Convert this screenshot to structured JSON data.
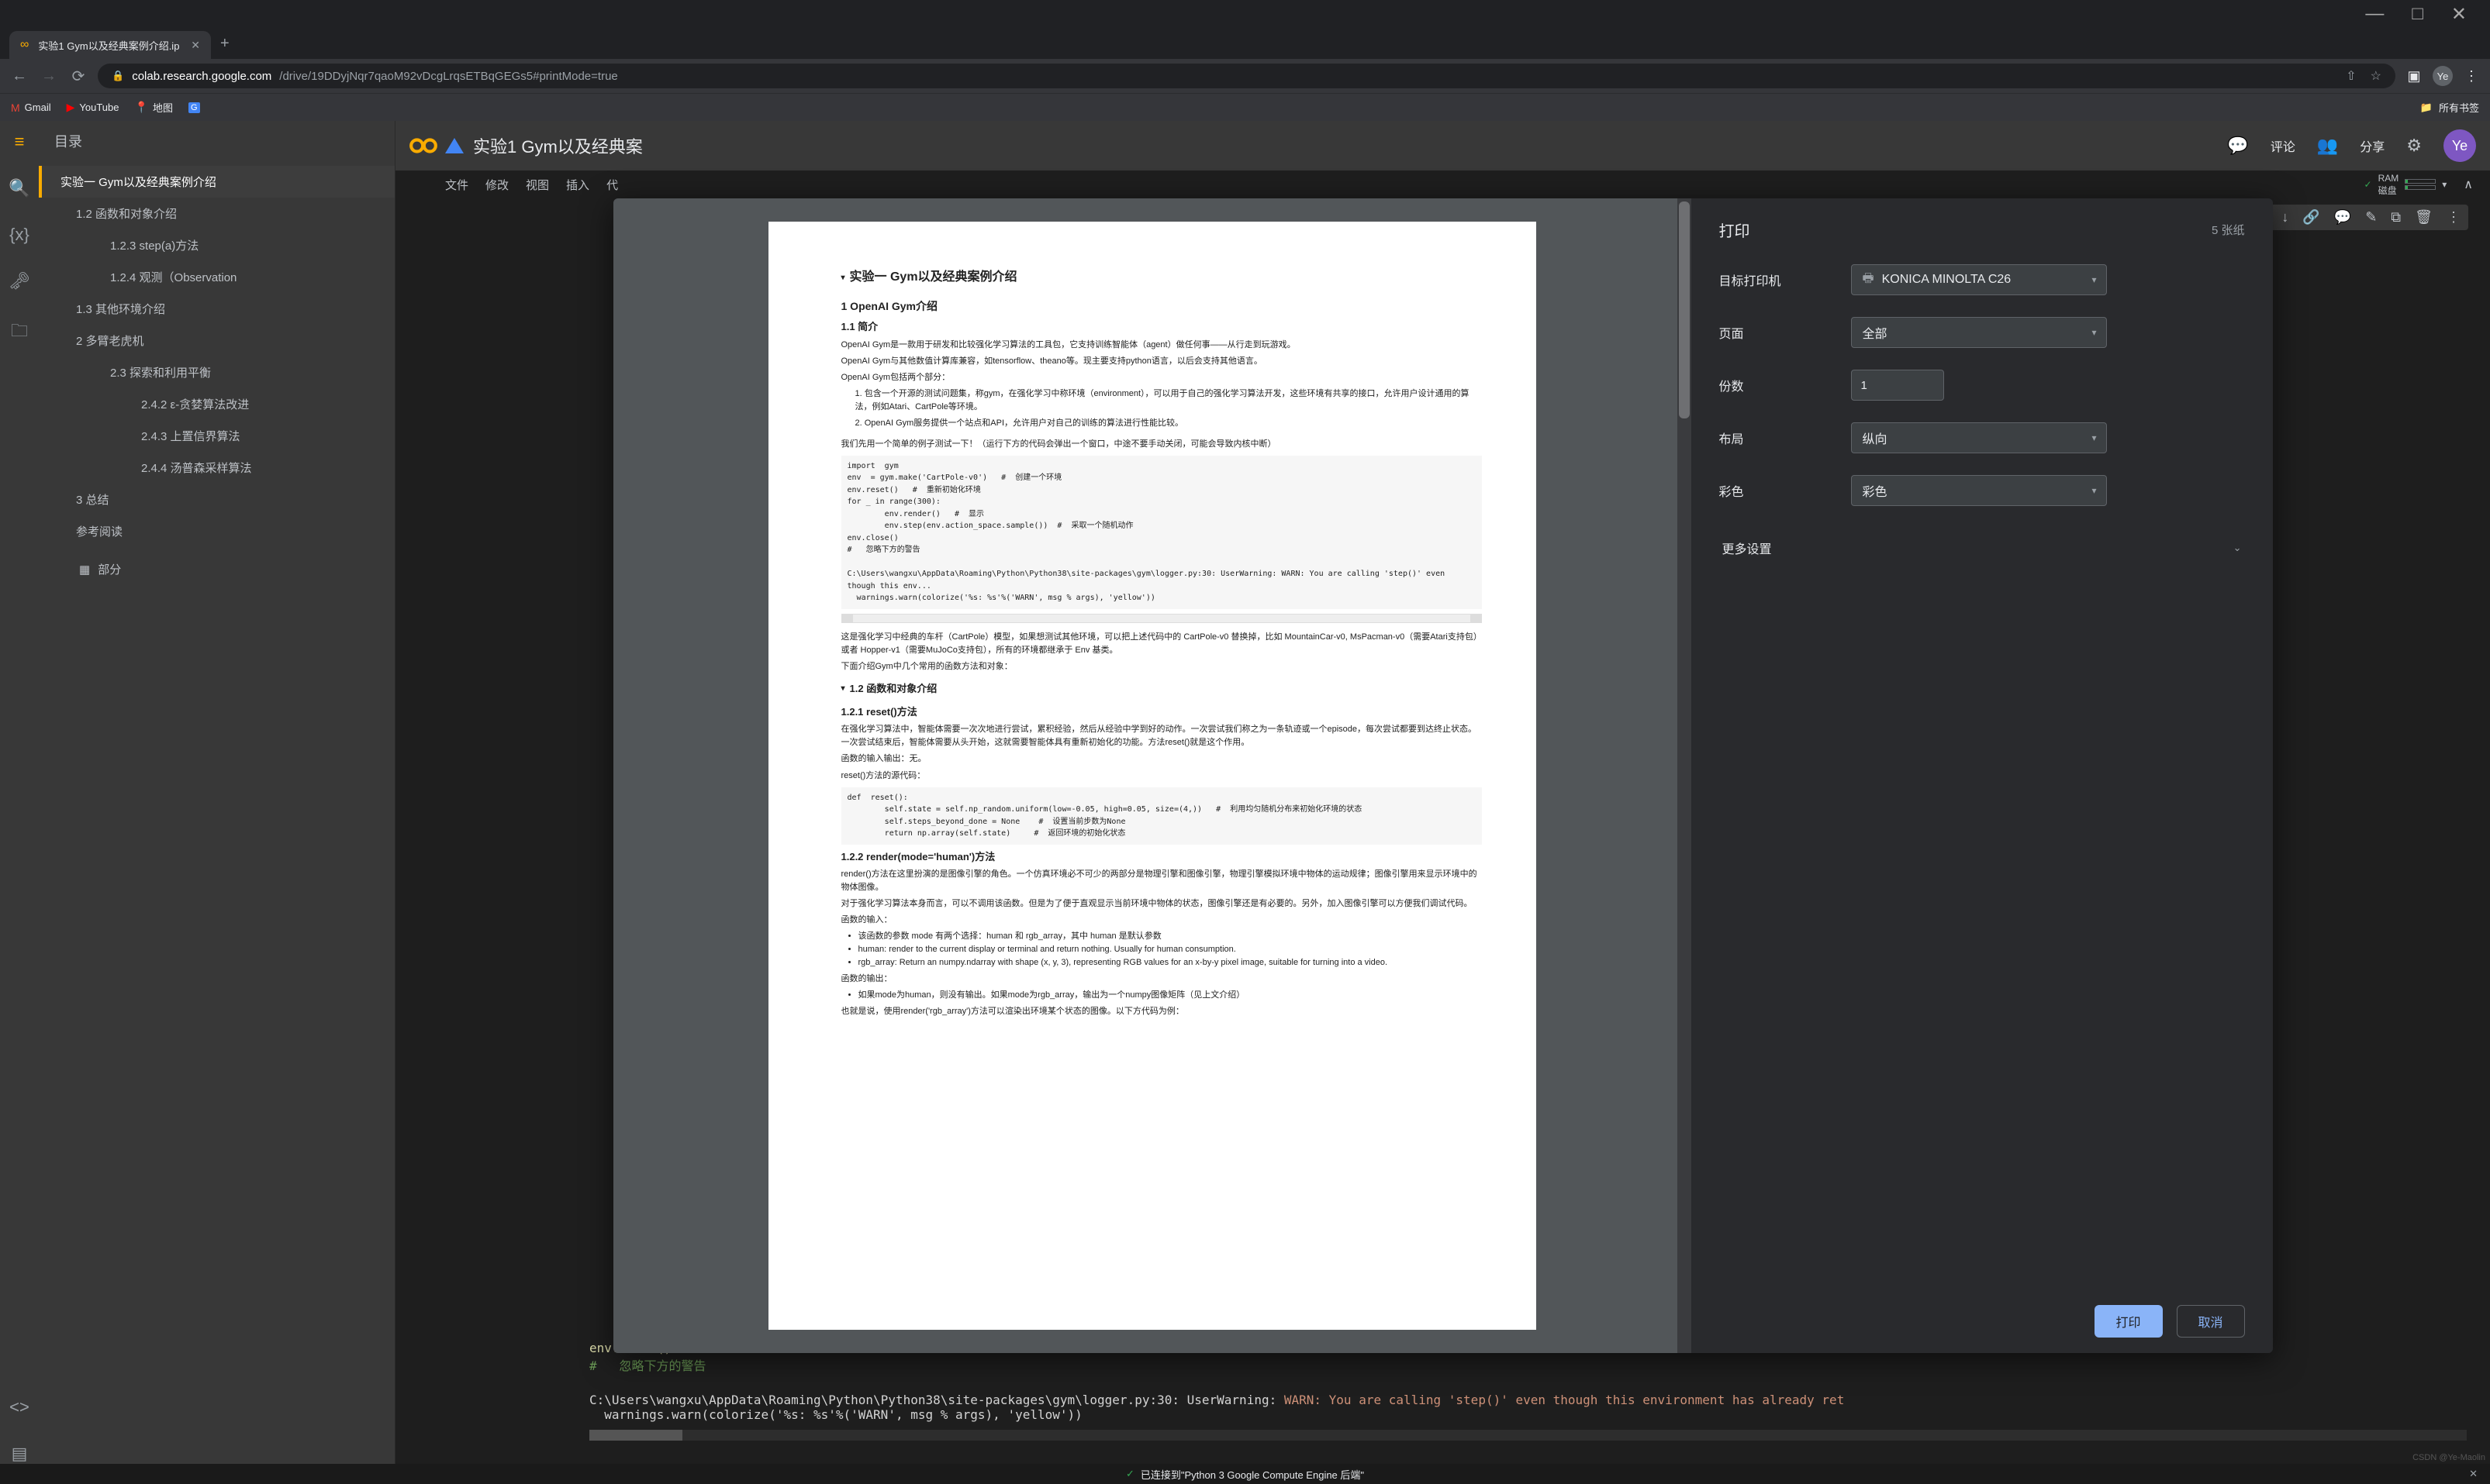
{
  "browser": {
    "tab_title": "实验1 Gym以及经典案例介绍.ip",
    "tab_close": "✕",
    "url_host": "colab.research.google.com",
    "url_path": "/drive/19DDyjNqr7qaoM92vDcgLrqsETBqGEGs5#printMode=true",
    "bookmarks": {
      "gmail": "Gmail",
      "youtube": "YouTube",
      "maps": "地图",
      "all": "所有书签"
    },
    "win_min": "—",
    "win_max": "□",
    "win_close": "✕",
    "avatar": "Ye"
  },
  "colab": {
    "doc_title": "实验1 Gym以及经典案",
    "menu": {
      "file": "文件",
      "edit": "修改",
      "view": "视图",
      "insert": "插入",
      "code": "代"
    },
    "hdr": {
      "comment": "评论",
      "share": "分享",
      "avatar": "Ye"
    },
    "ram": {
      "check": "✓",
      "ram": "RAM",
      "disk": "磁盘"
    },
    "toc": {
      "title": "目录",
      "items": {
        "a": "实验一 Gym以及经典案例介绍",
        "b": "1.2 函数和对象介绍",
        "c": "1.2.3 step(a)方法",
        "d": "1.2.4 观测（Observation",
        "e": "1.3 其他环境介绍",
        "f": "2 多臂老虎机",
        "g": "2.3 探索和利用平衡",
        "h": "2.4.2 ε-贪婪算法改进",
        "i": "2.4.3 上置信界算法",
        "j": "2.4.4 汤普森采样算法",
        "k": "3 总结",
        "l": "参考阅读",
        "add": "部分"
      }
    },
    "output": {
      "l1": "env.close()",
      "l2a": "#   ",
      "l2b": "忽略下方的警告",
      "l3a": "C:\\Users\\wangxu\\AppData\\Roaming\\Python\\Python38\\site-packages\\gym\\logger.py:30: UserWarning: ",
      "l3b": "WARN: You are calling 'step()' even though this environment has already ret",
      "l4": "  warnings.warn(colorize('%s: %s'%('WARN', msg % args), 'yellow'))"
    }
  },
  "print": {
    "title": "打印",
    "sheets": "5 张纸",
    "rows": {
      "dest_lbl": "目标打印机",
      "dest_val": "KONICA MINOLTA C26",
      "pages_lbl": "页面",
      "pages_val": "全部",
      "copies_lbl": "份数",
      "copies_val": "1",
      "layout_lbl": "布局",
      "layout_val": "纵向",
      "color_lbl": "彩色",
      "color_val": "彩色"
    },
    "more": "更多设置",
    "print_btn": "打印",
    "cancel_btn": "取消"
  },
  "doc": {
    "h1": "实验一 Gym以及经典案例介绍",
    "h2": "1 OpenAI Gym介绍",
    "h3": "1.1 简介",
    "p1": "OpenAI Gym是一款用于研发和比较强化学习算法的工具包，它支持训练智能体（agent）做任何事——从行走到玩游戏。",
    "p2": "OpenAI Gym与其他数值计算库兼容，如tensorflow、theano等。现主要支持python语言，以后会支持其他语言。",
    "p3": "OpenAI Gym包括两个部分：",
    "li1": "1. 包含一个开源的测试问题集，称gym，在强化学习中称环境（environment），可以用于自己的强化学习算法开发，这些环境有共享的接口，允许用户设计通用的算法，例如Atari、CartPole等环境。",
    "li2": "2. OpenAI Gym服务提供一个站点和API，允许用户对自己的训练的算法进行性能比较。",
    "p4": "我们先用一个简单的例子测试一下！（运行下方的代码会弹出一个窗口，中途不要手动关闭，可能会导致内核中断）",
    "code1": "import  gym\nenv  = gym.make('CartPole-v0')   #  创建一个环境\nenv.reset()   #  重新初始化环境\nfor _ in range(300):\n        env.render()   #  显示\n        env.step(env.action_space.sample())  #  采取一个随机动作\nenv.close()\n#   忽略下方的警告\n\nC:\\Users\\wangxu\\AppData\\Roaming\\Python\\Python38\\site-packages\\gym\\logger.py:30: UserWarning: WARN: You are calling 'step()' even though this env...\n  warnings.warn(colorize('%s: %s'%('WARN', msg % args), 'yellow'))",
    "p5": "这是强化学习中经典的车杆（CartPole）模型，如果想测试其他环境，可以把上述代码中的 CartPole-v0 替换掉，比如 MountainCar-v0, MsPacman-v0（需要Atari支持包）或者 Hopper-v1（需要MuJoCo支持包），所有的环境都继承于 Env 基类。",
    "p6": "下面介绍Gym中几个常用的函数方法和对象：",
    "h4": "1.2 函数和对象介绍",
    "h5": "1.2.1 reset()方法",
    "p7": "在强化学习算法中，智能体需要一次次地进行尝试，累积经验，然后从经验中学到好的动作。一次尝试我们称之为一条轨迹或一个episode，每次尝试都要到达终止状态。一次尝试结束后，智能体需要从头开始，这就需要智能体具有重新初始化的功能。方法reset()就是这个作用。",
    "p8": "函数的输入输出：无。",
    "p9": "reset()方法的源代码：",
    "code2": "def  reset():\n        self.state = self.np_random.uniform(low=-0.05, high=0.05, size=(4,))   #  利用均匀随机分布来初始化环境的状态\n        self.steps_beyond_done = None    #  设置当前步数为None\n        return np.array(self.state)     #  返回环境的初始化状态",
    "h6": "1.2.2 render(mode='human')方法",
    "p10": "render()方法在这里扮演的是图像引擎的角色。一个仿真环境必不可少的两部分是物理引擎和图像引擎，物理引擎模拟环境中物体的运动规律；图像引擎用来显示环境中的物体图像。",
    "p11": "对于强化学习算法本身而言，可以不调用该函数。但是为了便于直观显示当前环境中物体的状态，图像引擎还是有必要的。另外，加入图像引擎可以方便我们调试代码。",
    "p12": "函数的输入：",
    "u1": "该函数的参数 mode 有两个选择：human 和 rgb_array，其中 human 是默认参数",
    "u2": "human: render to the current display or terminal and return nothing. Usually for human consumption.",
    "u3": "rgb_array: Return an numpy.ndarray with shape (x, y, 3), representing RGB values for an x-by-y pixel image, suitable for turning into a video.",
    "p13": "函数的输出：",
    "u4": "如果mode为human，则没有输出。如果mode为rgb_array，输出为一个numpy图像矩阵（见上文介绍）",
    "p14": "也就是说，使用render('rgb_array')方法可以渲染出环境某个状态的图像。以下方代码为例："
  },
  "status": {
    "text": "已连接到\"Python 3 Google Compute Engine 后端\""
  },
  "watermark": "CSDN @Ye-Maolin"
}
